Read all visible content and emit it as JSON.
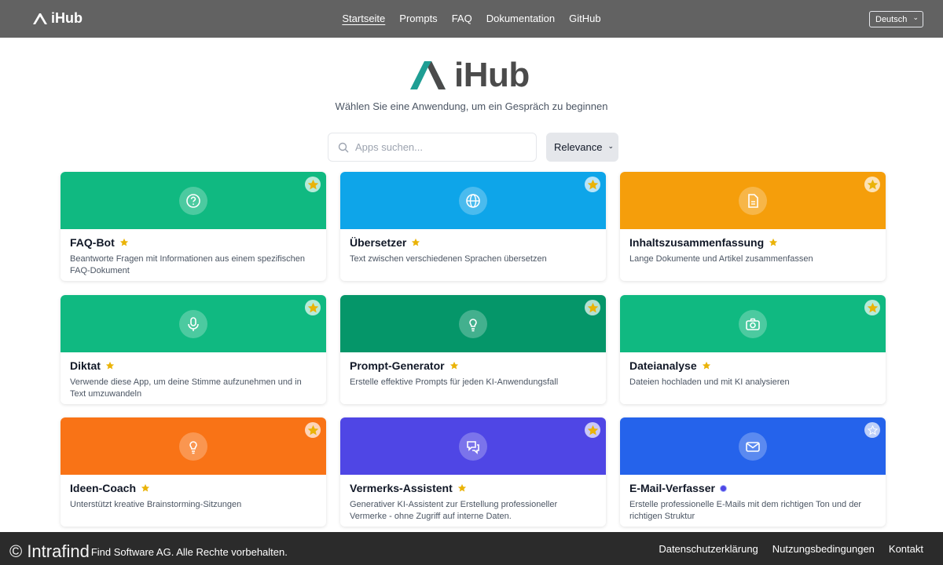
{
  "header": {
    "brand": "iHub",
    "nav": [
      "Startseite",
      "Prompts",
      "FAQ",
      "Dokumentation",
      "GitHub"
    ],
    "language": "Deutsch"
  },
  "hero": {
    "logo_text": "iHub",
    "subtitle": "Wählen Sie eine Anwendung, um ein Gespräch zu beginnen"
  },
  "search": {
    "placeholder": "Apps suchen...",
    "value": ""
  },
  "sort": {
    "selected": "Relevance"
  },
  "apps": [
    {
      "title": "FAQ-Bot",
      "description": "Beantworte Fragen mit Informationen aus einem spezifischen FAQ-Dokument",
      "color": "#10b981",
      "icon": "question-icon",
      "favorite": true,
      "badge": "star"
    },
    {
      "title": "Übersetzer",
      "description": "Text zwischen verschiedenen Sprachen übersetzen",
      "color": "#0ea5e9",
      "icon": "globe-icon",
      "favorite": true,
      "badge": "star"
    },
    {
      "title": "Inhaltszusammenfassung",
      "description": "Lange Dokumente und Artikel zusammenfassen",
      "color": "#f59e0b",
      "icon": "document-icon",
      "favorite": true,
      "badge": "star"
    },
    {
      "title": "Diktat",
      "description": "Verwende diese App, um deine Stimme aufzunehmen und in Text umzuwandeln",
      "color": "#10b981",
      "icon": "microphone-icon",
      "favorite": true,
      "badge": "star"
    },
    {
      "title": "Prompt-Generator",
      "description": "Erstelle effektive Prompts für jeden KI-Anwendungsfall",
      "color": "#059669",
      "icon": "lightbulb-icon",
      "favorite": true,
      "badge": "star"
    },
    {
      "title": "Dateianalyse",
      "description": "Dateien hochladen und mit KI analysieren",
      "color": "#10b981",
      "icon": "camera-icon",
      "favorite": true,
      "badge": "star"
    },
    {
      "title": "Ideen-Coach",
      "description": "Unterstützt kreative Brainstorming-Sitzungen",
      "color": "#f97316",
      "icon": "lightbulb-icon",
      "favorite": true,
      "badge": "star"
    },
    {
      "title": "Vermerks-Assistent",
      "description": "Generativer KI-Assistent zur Erstellung professioneller Vermerke - ohne Zugriff auf interne Daten.",
      "color": "#4f46e5",
      "icon": "chat-icon",
      "favorite": true,
      "badge": "star"
    },
    {
      "title": "E-Mail-Verfasser",
      "description": "Erstelle professionelle E-Mails mit dem richtigen Ton und der richtigen Struktur",
      "color": "#2563eb",
      "icon": "mail-icon",
      "favorite": false,
      "badge": "dot"
    }
  ],
  "footer": {
    "watermark": "© Intrafind",
    "copyright": "Find Software AG. Alle Rechte vorbehalten.",
    "links": [
      "Datenschutzerklärung",
      "Nutzungsbedingungen",
      "Kontakt"
    ]
  }
}
